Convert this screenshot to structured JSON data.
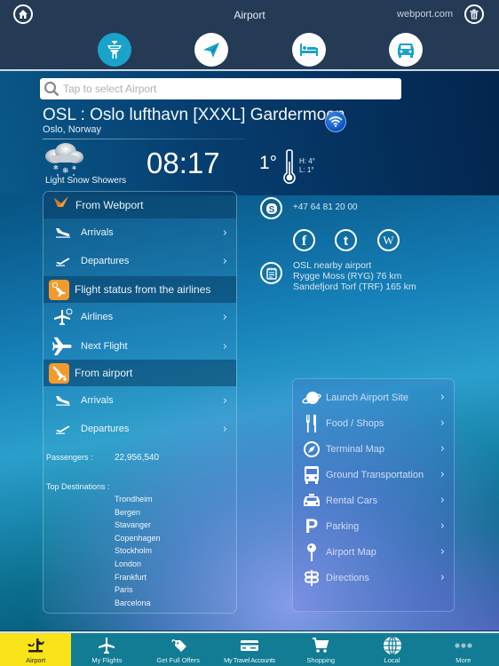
{
  "header": {
    "title": "Airport",
    "webport_link": "webport.com"
  },
  "top_nav": [
    {
      "name": "airport-tower",
      "active": true
    },
    {
      "name": "flights-plane",
      "active": false
    },
    {
      "name": "hotel-bed",
      "active": false
    },
    {
      "name": "car-rental",
      "active": false
    }
  ],
  "search": {
    "placeholder": "Tap to select Airport",
    "value": ""
  },
  "airport": {
    "name": "OSL : Oslo lufthavn [XXXL] Gardermoen",
    "location": "Oslo, Norway"
  },
  "weather": {
    "condition": "Light Snow Showers",
    "time": "08:17",
    "temperature": "1°",
    "high": "H: 4°",
    "low": "L: 1°"
  },
  "left_panel": {
    "sections": [
      {
        "header": "From Webport",
        "items": [
          {
            "label": "Arrivals",
            "icon": "plane-landing-icon"
          },
          {
            "label": "Departures",
            "icon": "plane-takeoff-icon"
          }
        ]
      },
      {
        "header": "Flight status from the airlines",
        "items": [
          {
            "label": "Airlines",
            "icon": "plane-clock-icon"
          },
          {
            "label": "Next Flight",
            "icon": "plane-icon"
          }
        ]
      },
      {
        "header": "From airport",
        "items": [
          {
            "label": "Arrivals",
            "icon": "plane-landing-icon"
          },
          {
            "label": "Departures",
            "icon": "plane-takeoff-icon"
          }
        ]
      }
    ],
    "passengers_label": "Passengers :",
    "passengers_value": "22,956,540",
    "top_destinations_label": "Top  Destinations :",
    "top_destinations": [
      "Trondheim",
      "Bergen",
      "Stavanger",
      "Copenhagen",
      "Stockholm",
      "London",
      "Frankfurt",
      "Paris",
      "Barcelona"
    ]
  },
  "contact": {
    "phone": "+47 64 81 20 00",
    "social": [
      "facebook",
      "twitter",
      "wikipedia"
    ],
    "nearby_title": "OSL nearby airport",
    "nearby": [
      "Rygge Moss (RYG) 76 km",
      "Sandefjord Torf (TRF) 165 km"
    ]
  },
  "right_panel": {
    "items": [
      {
        "label": "Launch Airport Site",
        "icon": "planet-icon"
      },
      {
        "label": "Food / Shops",
        "icon": "fork-knife-icon"
      },
      {
        "label": "Terminal Map",
        "icon": "compass-icon"
      },
      {
        "label": "Ground Transportation",
        "icon": "bus-icon"
      },
      {
        "label": "Rental Cars",
        "icon": "taxi-icon"
      },
      {
        "label": "Parking",
        "icon": "parking-icon"
      },
      {
        "label": "Airport Map",
        "icon": "map-pin-icon"
      },
      {
        "label": "Directions",
        "icon": "signpost-icon"
      }
    ]
  },
  "tabbar": {
    "tabs": [
      {
        "label": "Airport",
        "active": true
      },
      {
        "label": "My Flights",
        "active": false
      },
      {
        "label": "Get Full Offers",
        "active": false
      },
      {
        "label": "My Travel Accounts",
        "active": false
      },
      {
        "label": "Shopping",
        "active": false
      },
      {
        "label": "Local",
        "active": false
      },
      {
        "label": "More",
        "active": false
      }
    ]
  },
  "colors": {
    "header_bg": "#243a55",
    "accent_cyan": "#1aa3c9",
    "orange": "#f39a2c",
    "tab_active": "#f8e318",
    "tabbar_bg": "#127c95"
  }
}
